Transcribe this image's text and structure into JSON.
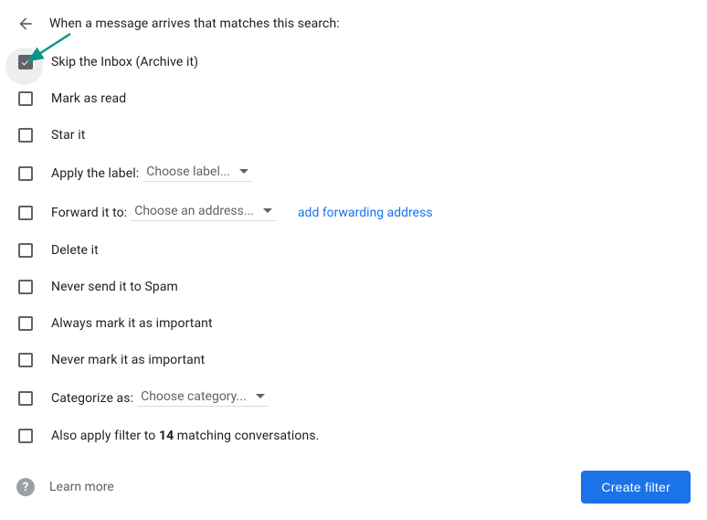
{
  "header": {
    "title": "When a message arrives that matches this search:"
  },
  "options": {
    "skip_inbox": {
      "label": "Skip the Inbox (Archive it)",
      "checked": true
    },
    "mark_read": {
      "label": "Mark as read",
      "checked": false
    },
    "star_it": {
      "label": "Star it",
      "checked": false
    },
    "apply_label": {
      "label_prefix": "Apply the label:",
      "dropdown": "Choose label...",
      "checked": false
    },
    "forward_to": {
      "label_prefix": "Forward it to:",
      "dropdown": "Choose an address...",
      "link": "add forwarding address",
      "checked": false
    },
    "delete_it": {
      "label": "Delete it",
      "checked": false
    },
    "never_spam": {
      "label": "Never send it to Spam",
      "checked": false
    },
    "always_important": {
      "label": "Always mark it as important",
      "checked": false
    },
    "never_important": {
      "label": "Never mark it as important",
      "checked": false
    },
    "categorize": {
      "label_prefix": "Categorize as:",
      "dropdown": "Choose category...",
      "checked": false
    },
    "also_apply": {
      "prefix": "Also apply filter to ",
      "count": "14",
      "suffix": " matching conversations.",
      "checked": false
    }
  },
  "footer": {
    "learn_more": "Learn more",
    "create_filter": "Create filter"
  },
  "icons": {
    "help_glyph": "?"
  }
}
